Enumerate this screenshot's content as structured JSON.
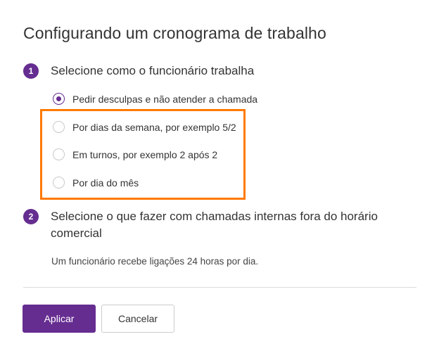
{
  "dialog": {
    "title": "Configurando um cronograma de trabalho"
  },
  "step1": {
    "number": "1",
    "title": "Selecione como o funcionário trabalha",
    "options": [
      {
        "label": "Pedir desculpas e não atender a chamada",
        "selected": true
      },
      {
        "label": "Por dias da semana, por exemplo 5/2",
        "selected": false
      },
      {
        "label": "Em turnos, por exemplo 2 após 2",
        "selected": false
      },
      {
        "label": "Por dia do mês",
        "selected": false
      }
    ]
  },
  "step2": {
    "number": "2",
    "title_line1": "Selecione o que fazer com chamadas internas fora do horário",
    "title_line2": "comercial",
    "hint": "Um funcionário recebe ligações 24 horas por dia."
  },
  "actions": {
    "apply_label": "Aplicar",
    "cancel_label": "Cancelar"
  },
  "colors": {
    "accent": "#662d91",
    "highlight": "#ff7a00"
  }
}
